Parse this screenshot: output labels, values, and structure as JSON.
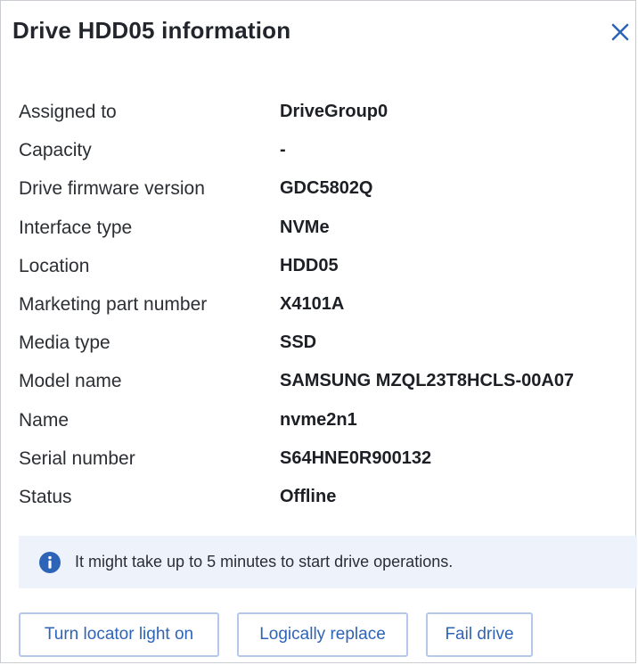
{
  "dialog": {
    "title": "Drive HDD05 information",
    "close_icon": "close-icon"
  },
  "properties": [
    {
      "label": "Assigned to",
      "value": "DriveGroup0"
    },
    {
      "label": "Capacity",
      "value": "-"
    },
    {
      "label": "Drive firmware version",
      "value": "GDC5802Q"
    },
    {
      "label": "Interface type",
      "value": "NVMe"
    },
    {
      "label": "Location",
      "value": "HDD05"
    },
    {
      "label": "Marketing part number",
      "value": "X4101A"
    },
    {
      "label": "Media type",
      "value": "SSD"
    },
    {
      "label": "Model name",
      "value": "SAMSUNG MZQL23T8HCLS-00A07"
    },
    {
      "label": "Name",
      "value": "nvme2n1"
    },
    {
      "label": "Serial number",
      "value": "S64HNE0R900132"
    },
    {
      "label": "Status",
      "value": "Offline"
    }
  ],
  "notice": {
    "icon": "info-icon",
    "text": "It might take up to 5 minutes to start drive operations."
  },
  "actions": {
    "locator_label": "Turn locator light on",
    "replace_label": "Logically replace",
    "fail_label": "Fail drive"
  },
  "colors": {
    "accent": "#2e64b8",
    "notice_bg": "#eef3fb",
    "button_border": "#b7c7e8"
  }
}
